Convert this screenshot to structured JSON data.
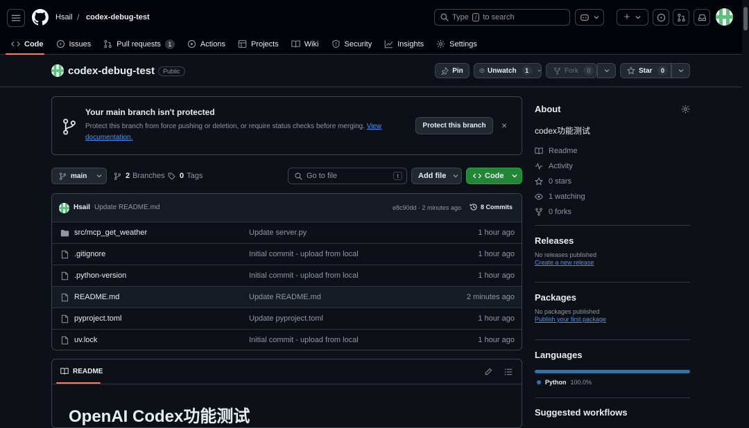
{
  "header": {
    "owner": "Hsail",
    "separator": "/",
    "repo": "codex-debug-test",
    "search_prefix": "Type",
    "search_key": "/",
    "search_suffix": "to search",
    "plus": "+"
  },
  "nav": [
    {
      "label": "Code",
      "icon": "code-icon",
      "selected": true
    },
    {
      "label": "Issues",
      "icon": "issue-icon"
    },
    {
      "label": "Pull requests",
      "icon": "pull-request-icon",
      "count": "1"
    },
    {
      "label": "Actions",
      "icon": "play-icon"
    },
    {
      "label": "Projects",
      "icon": "table-icon"
    },
    {
      "label": "Wiki",
      "icon": "book-icon"
    },
    {
      "label": "Security",
      "icon": "shield-icon"
    },
    {
      "label": "Insights",
      "icon": "graph-icon"
    },
    {
      "label": "Settings",
      "icon": "gear-icon"
    }
  ],
  "repo_header": {
    "name": "codex-debug-test",
    "visibility": "Public",
    "pin": "Pin",
    "unwatch": "Unwatch",
    "watch_count": "1",
    "fork": "Fork",
    "fork_count": "0",
    "star": "Star",
    "star_count": "0"
  },
  "banner": {
    "title": "Your main branch isn't protected",
    "text": "Protect this branch from force pushing or deletion, or require status checks before merging.",
    "link1": "View",
    "link2": "documentation.",
    "button": "Protect this branch",
    "close": "×"
  },
  "toolbar": {
    "branch": "main",
    "branches_count": "2",
    "branches_label": "Branches",
    "tags_count": "0",
    "tags_label": "Tags",
    "goto_placeholder": "Go to file",
    "goto_key": "t",
    "add_file": "Add file",
    "code": "Code"
  },
  "commit": {
    "author": "Hsail",
    "message": "Update README.md",
    "meta": "e8c90dd · 2 minutes ago",
    "commits": "8 Commits"
  },
  "files": [
    {
      "name": "src/mcp_get_weather",
      "type": "folder",
      "message": "Update server.py",
      "time": "1 hour ago"
    },
    {
      "name": ".gitignore",
      "type": "file",
      "message": "Initial commit - upload from local",
      "time": "1 hour ago"
    },
    {
      "name": ".python-version",
      "type": "file",
      "message": "Initial commit - upload from local",
      "time": "1 hour ago"
    },
    {
      "name": "README.md",
      "type": "file",
      "message": "Update README.md",
      "time": "2 minutes ago"
    },
    {
      "name": "pyproject.toml",
      "type": "file",
      "message": "Update pyproject.toml",
      "time": "1 hour ago"
    },
    {
      "name": "uv.lock",
      "type": "file",
      "message": "Initial commit - upload from local",
      "time": "1 hour ago"
    }
  ],
  "readme": {
    "tab": "README",
    "heading": "OpenAI Codex功能测试"
  },
  "about": {
    "title": "About",
    "description": "codex功能测试",
    "items": [
      {
        "label": "Readme",
        "icon": "book-icon"
      },
      {
        "label": "Activity",
        "icon": "pulse-icon"
      },
      {
        "label": "0 stars",
        "icon": "star-icon"
      },
      {
        "label": "1 watching",
        "icon": "eye-icon"
      },
      {
        "label": "0 forks",
        "icon": "fork-icon"
      }
    ]
  },
  "releases": {
    "title": "Releases",
    "text": "No releases published",
    "link": "Create a new release"
  },
  "packages": {
    "title": "Packages",
    "text": "No packages published",
    "link": "Publish your first package"
  },
  "languages": {
    "title": "Languages",
    "name": "Python",
    "percent": "100.0%",
    "color": "#3572A5"
  },
  "suggested": {
    "title": "Suggested workflows"
  }
}
